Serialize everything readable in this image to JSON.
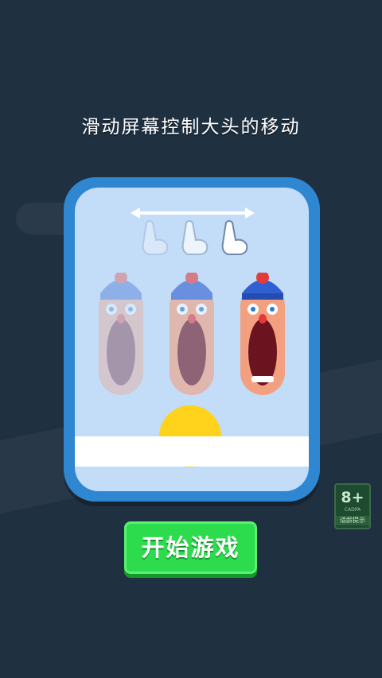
{
  "instruction": "滑动屏幕控制大头的移动",
  "start_button": "开始游戏",
  "age_rating": {
    "value": "8+",
    "code": "CADPA",
    "note": "适龄提示"
  },
  "colors": {
    "background": "#1f3041",
    "card_border": "#2f86d1",
    "card_fill": "#c3dcf7",
    "button": "#2ddc4c",
    "sun": "#ffd21c"
  },
  "icons": [
    "swipe-arrow-icon",
    "pointing-hand-icon"
  ]
}
